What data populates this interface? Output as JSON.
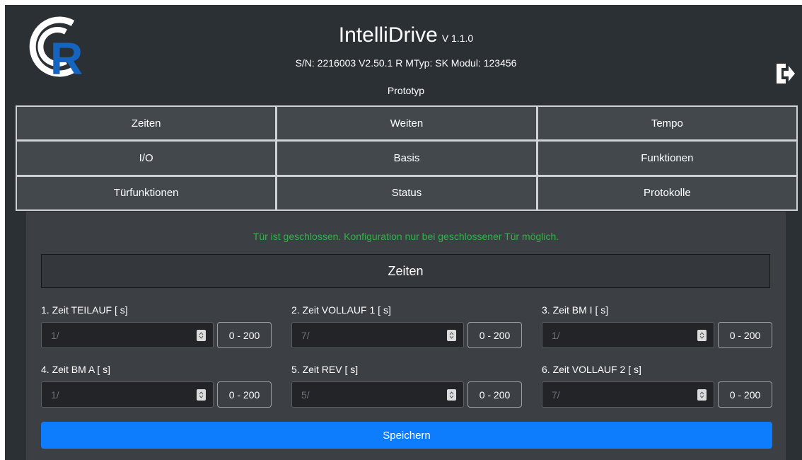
{
  "header": {
    "logo_letter": "R",
    "title": "IntelliDrive",
    "version": "V 1.1.0",
    "serial_line": "S/N: 2216003 V2.50.1 R MTyp: SK Modul: 123456",
    "subtitle": "Prototyp",
    "exit_icon": "sign-out-icon"
  },
  "nav": {
    "items": [
      {
        "label": "Zeiten"
      },
      {
        "label": "Weiten"
      },
      {
        "label": "Tempo"
      },
      {
        "label": "I/O"
      },
      {
        "label": "Basis"
      },
      {
        "label": "Funktionen"
      },
      {
        "label": "Türfunktionen"
      },
      {
        "label": "Status"
      },
      {
        "label": "Protokolle"
      }
    ]
  },
  "panel": {
    "notice": "Tür ist geschlossen. Konfiguration nur bei geschlossener Tür möglich.",
    "section_title": "Zeiten",
    "fields": [
      {
        "label": "1. Zeit TEILAUF [ s]",
        "value": "1/",
        "range": "0 - 200"
      },
      {
        "label": "2. Zeit VOLLAUF 1 [ s]",
        "value": "7/",
        "range": "0 - 200"
      },
      {
        "label": "3. Zeit BM I [ s]",
        "value": "1/",
        "range": "0 - 200"
      },
      {
        "label": "4. Zeit BM A [ s]",
        "value": "1/",
        "range": "0 - 200"
      },
      {
        "label": "5. Zeit REV [ s]",
        "value": "5/",
        "range": "0 - 200"
      },
      {
        "label": "6. Zeit VOLLAUF 2 [ s]",
        "value": "7/",
        "range": "0 - 200"
      }
    ],
    "save_label": "Speichern"
  },
  "colors": {
    "background": "#2b3035",
    "nav_button": "#43484d",
    "notice_green": "#2fb344",
    "primary_blue": "#0d7dfd",
    "logo_blue": "#1565c0"
  }
}
